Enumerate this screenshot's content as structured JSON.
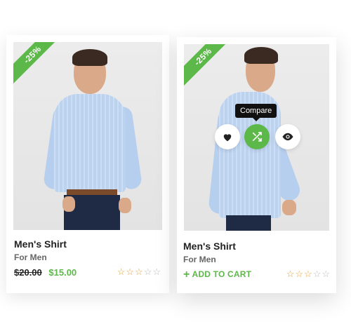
{
  "products": [
    {
      "discount": "-25%",
      "title": "Men's Shirt",
      "subtitle": "For Men",
      "old_price": "$20.00",
      "new_price": "$15.00",
      "rating": 3,
      "rating_max": 5
    },
    {
      "discount": "-25%",
      "title": "Men's Shirt",
      "subtitle": "For Men",
      "add_to_cart": "ADD TO CART",
      "tooltip": "Compare",
      "rating": 3,
      "rating_max": 5,
      "actions": [
        "heart-icon",
        "shuffle-icon",
        "eye-icon"
      ]
    }
  ],
  "colors": {
    "accent": "#5cb849",
    "star": "#e9a23b"
  }
}
